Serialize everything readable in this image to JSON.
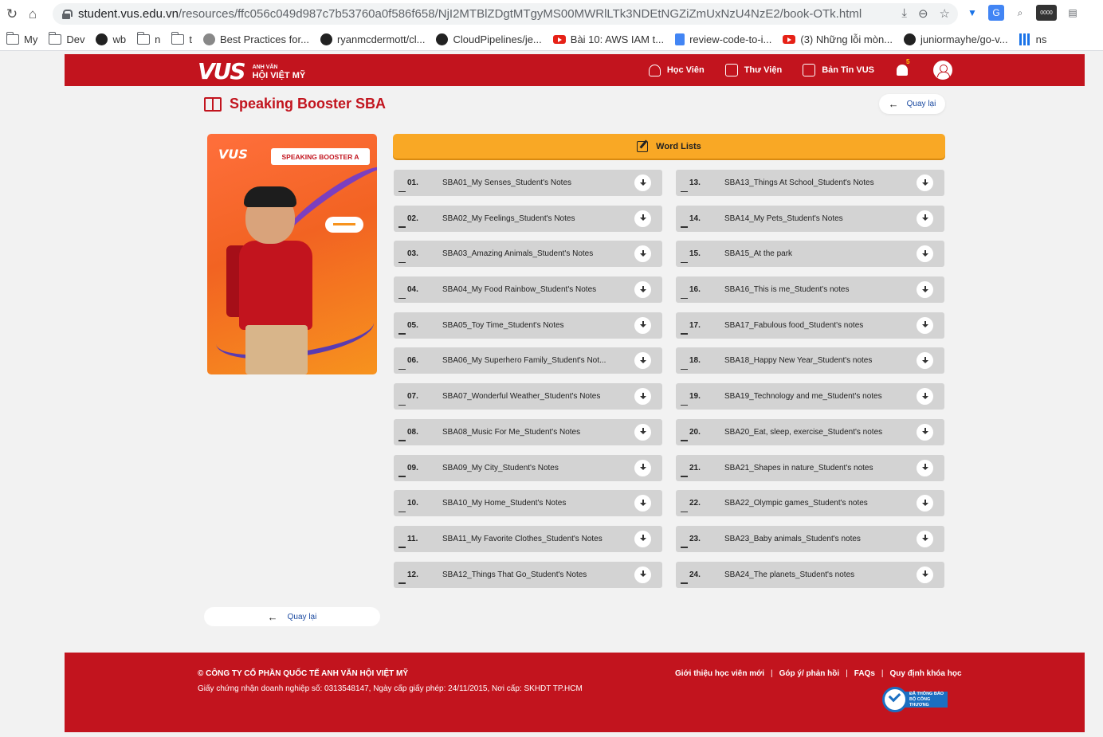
{
  "browser": {
    "url_host": "student.vus.edu.vn",
    "url_path": "/resources/ffc056c049d987c7b53760a0f586f658/NjI2MTBlZDgtMTgyMS00MWRlLTk3NDEtNGZiZmUxNzU4NzE2/book-OTk.html",
    "ext_badge": "0000",
    "bookmarks": [
      "My",
      "Dev",
      "wb",
      "n",
      "t",
      "Best Practices for...",
      "ryanmcdermott/cl...",
      "CloudPipelines/je...",
      "Bài 10: AWS IAM t...",
      "review-code-to-i...",
      "(3) Những lỗi mòn...",
      "juniormayhe/go-v...",
      "ns"
    ]
  },
  "header": {
    "logo_mark": "VUS",
    "logo_sub": "ANH VĂN",
    "logo_main": "HỘI VIỆT MỸ",
    "nav": [
      "Học Viên",
      "Thư Viện",
      "Bản Tin VUS"
    ],
    "notification_count": "5"
  },
  "page": {
    "title": "Speaking Booster SBA",
    "back_label": "Quay lại",
    "cover_logo": "VUS",
    "cover_tag": "SPEAKING BOOSTER A",
    "section_label": "Word Lists"
  },
  "files_left": [
    {
      "num": "01.",
      "name": "SBA01_My Senses_Student's Notes"
    },
    {
      "num": "02.",
      "name": "SBA02_My Feelings_Student's Notes"
    },
    {
      "num": "03.",
      "name": "SBA03_Amazing Animals_Student's Notes"
    },
    {
      "num": "04.",
      "name": "SBA04_My Food Rainbow_Student's Notes"
    },
    {
      "num": "05.",
      "name": "SBA05_Toy Time_Student's Notes"
    },
    {
      "num": "06.",
      "name": "SBA06_My Superhero Family_Student's Not..."
    },
    {
      "num": "07.",
      "name": "SBA07_Wonderful Weather_Student's Notes"
    },
    {
      "num": "08.",
      "name": "SBA08_Music For Me_Student's Notes"
    },
    {
      "num": "09.",
      "name": "SBA09_My City_Student's Notes"
    },
    {
      "num": "10.",
      "name": "SBA10_My Home_Student's Notes"
    },
    {
      "num": "11.",
      "name": "SBA11_My Favorite Clothes_Student's Notes"
    },
    {
      "num": "12.",
      "name": "SBA12_Things That Go_Student's Notes"
    }
  ],
  "files_right": [
    {
      "num": "13.",
      "name": "SBA13_Things At School_Student's Notes"
    },
    {
      "num": "14.",
      "name": "SBA14_My Pets_Student's Notes"
    },
    {
      "num": "15.",
      "name": "SBA15_At the park"
    },
    {
      "num": "16.",
      "name": "SBA16_This is me_Student's notes"
    },
    {
      "num": "17.",
      "name": "SBA17_Fabulous food_Student's notes"
    },
    {
      "num": "18.",
      "name": "SBA18_Happy New Year_Student's notes"
    },
    {
      "num": "19.",
      "name": "SBA19_Technology and me_Student's notes"
    },
    {
      "num": "20.",
      "name": "SBA20_Eat, sleep, exercise_Student's notes"
    },
    {
      "num": "21.",
      "name": "SBA21_Shapes in nature_Student's notes"
    },
    {
      "num": "22.",
      "name": "SBA22_Olympic games_Student's notes"
    },
    {
      "num": "23.",
      "name": "SBA23_Baby animals_Student's notes"
    },
    {
      "num": "24.",
      "name": "SBA24_The planets_Student's notes"
    }
  ],
  "footer": {
    "company": "© CÔNG TY CỔ PHẦN QUỐC TẾ ANH VĂN HỘI VIỆT MỸ",
    "license": "Giấy chứng nhận doanh nghiệp số: 0313548147, Ngày cấp giấy phép: 24/11/2015, Nơi cấp: SKHDT TP.HCM",
    "links": [
      "Giới thiệu học viên mới",
      "Góp ý/ phản hồi",
      "FAQs",
      "Quy định khóa học"
    ],
    "badge_line1": "ĐÃ THÔNG BÁO",
    "badge_line2": "BỘ CÔNG THƯƠNG"
  },
  "colors": {
    "brand_red": "#c2141e",
    "accent_orange": "#f9a825",
    "row_gray": "#d3d3d3",
    "link_blue": "#1b4aa0"
  }
}
